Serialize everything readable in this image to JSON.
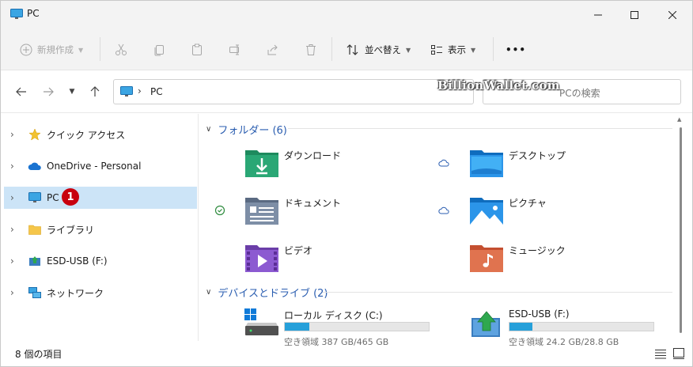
{
  "window": {
    "title": "PC"
  },
  "toolbar": {
    "new_label": "新規作成",
    "sort_label": "並べ替え",
    "view_label": "表示",
    "more_label": "•••"
  },
  "address": {
    "path": "PC",
    "search_placeholder": "PCの検索"
  },
  "watermark": "BillionWallet.com",
  "sidebar": {
    "items": [
      {
        "label": "クイック アクセス",
        "icon": "star-icon"
      },
      {
        "label": "OneDrive - Personal",
        "icon": "cloud-icon"
      },
      {
        "label": "PC",
        "icon": "monitor-icon",
        "selected": true
      },
      {
        "label": "ライブラリ",
        "icon": "folder-icon"
      },
      {
        "label": "ESD-USB (F:)",
        "icon": "usb-drive-icon"
      },
      {
        "label": "ネットワーク",
        "icon": "network-icon"
      }
    ],
    "badge": "1"
  },
  "groups": {
    "folders": {
      "title": "フォルダー (6)"
    },
    "drives": {
      "title": "デバイスとドライブ (2)"
    }
  },
  "folders": [
    {
      "name": "ダウンロード",
      "icon": "downloads-folder-icon",
      "status": ""
    },
    {
      "name": "デスクトップ",
      "icon": "desktop-folder-icon",
      "status": "cloud"
    },
    {
      "name": "ドキュメント",
      "icon": "documents-folder-icon",
      "status": "synced"
    },
    {
      "name": "ピクチャ",
      "icon": "pictures-folder-icon",
      "status": "cloud"
    },
    {
      "name": "ビデオ",
      "icon": "videos-folder-icon",
      "status": ""
    },
    {
      "name": "ミュージック",
      "icon": "music-folder-icon",
      "status": ""
    }
  ],
  "drives": [
    {
      "name": "ローカル ディスク (C:)",
      "free": "空き領域 387 GB/465 GB",
      "used_fraction": 0.17
    },
    {
      "name": "ESD-USB (F:)",
      "free": "空き領域 24.2 GB/28.8 GB",
      "used_fraction": 0.16
    }
  ],
  "status": {
    "item_count": "8 個の項目"
  },
  "colors": {
    "accent": "#26a0da",
    "selection": "#cce4f7",
    "badge": "#c8000e",
    "group_title": "#2a5db0"
  }
}
